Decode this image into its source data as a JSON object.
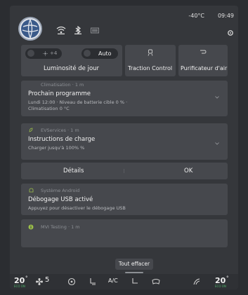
{
  "status": {
    "temperature": "-40°C",
    "time": "09:49"
  },
  "quick_controls": {
    "brightness_value": "+4",
    "auto_label": "Auto",
    "brightness_label": "Luminosité de jour",
    "traction_label": "Traction Control",
    "air_label": "Purificateur d'air"
  },
  "notifications": [
    {
      "source": "Climatisation · 1 m",
      "title": "Prochain programme",
      "subtitle1": "Lundi 12:00 · Niveau de batterie cible 0 % ·",
      "subtitle2": "Climatisation 0 °C"
    },
    {
      "source": "EVServices · 1 m",
      "title": "Instructions de charge",
      "subtitle1": "Charger jusqu'à 100% %",
      "btn_details": "Détails",
      "btn_ok": "OK"
    },
    {
      "source": "Système Android",
      "title": "Débogage USB activé",
      "subtitle1": "Appuyez pour désactiver le débogage USB"
    },
    {
      "source": "MVI Testing · 1 m"
    }
  ],
  "clear_all": "Tout effacer",
  "bottom": {
    "left_temp": "20",
    "left_temp_unit": "°",
    "left_eco": "ECO ON",
    "fan_level": "5",
    "ac_label": "A/C",
    "right_temp": "20",
    "right_temp_unit": "°",
    "right_eco": "ECO ON"
  },
  "colors": {
    "eco_green": "#4fb36b",
    "accent_green": "#9bbf4a",
    "card_bg": "#46484d",
    "screen_bg": "#35373b"
  }
}
